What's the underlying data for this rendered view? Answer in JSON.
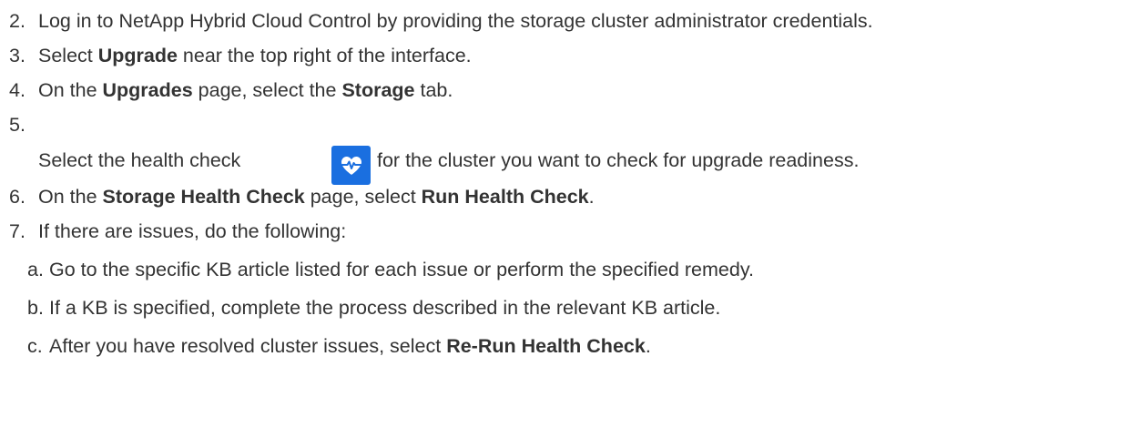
{
  "steps": [
    {
      "num": "2.",
      "parts": [
        {
          "t": "Log in to NetApp Hybrid Cloud Control by providing the storage cluster administrator credentials."
        }
      ]
    },
    {
      "num": "3.",
      "parts": [
        {
          "t": "Select "
        },
        {
          "t": "Upgrade",
          "b": true
        },
        {
          "t": " near the top right of the interface."
        }
      ]
    },
    {
      "num": "4.",
      "parts": [
        {
          "t": "On the "
        },
        {
          "t": "Upgrades",
          "b": true
        },
        {
          "t": " page, select the "
        },
        {
          "t": "Storage",
          "b": true
        },
        {
          "t": " tab."
        }
      ]
    },
    {
      "num": "5.",
      "parts": []
    },
    {
      "num": "",
      "parts": [
        {
          "t": "Select the health check"
        }
      ]
    },
    {
      "num": "",
      "parts": [
        {
          "t": "for the cluster you want to check for upgrade readiness."
        }
      ]
    },
    {
      "num": "6.",
      "parts": [
        {
          "t": "On the "
        },
        {
          "t": "Storage Health Check",
          "b": true
        },
        {
          "t": " page, select "
        },
        {
          "t": "Run Health Check",
          "b": true
        },
        {
          "t": "."
        }
      ]
    },
    {
      "num": "7.",
      "parts": [
        {
          "t": "If there are issues, do the following:"
        }
      ]
    }
  ],
  "substeps": [
    {
      "num": "a.",
      "parts": [
        {
          "t": "Go to the specific KB article listed for each issue or perform the specified remedy."
        }
      ]
    },
    {
      "num": "b.",
      "parts": [
        {
          "t": "If a KB is specified, complete the process described in the relevant KB article."
        }
      ]
    },
    {
      "num": "c.",
      "parts": [
        {
          "t": "After you have resolved cluster issues, select "
        },
        {
          "t": "Re-Run Health Check",
          "b": true
        },
        {
          "t": "."
        }
      ]
    }
  ],
  "health_icon": {
    "name": "heartbeat-icon",
    "color": "#1a6fe0"
  }
}
